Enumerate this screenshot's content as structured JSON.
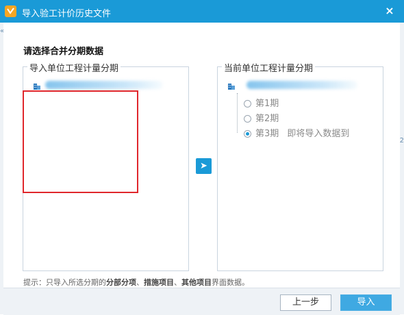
{
  "window": {
    "title": "导入验工计价历史文件",
    "close_glyph": "×"
  },
  "heading": "请选择合并分期数据",
  "left_group": {
    "title": "导入单位工程计量分期"
  },
  "right_group": {
    "title": "当前单位工程计量分期",
    "periods": [
      {
        "label": "第1期",
        "suffix": "",
        "checked": false
      },
      {
        "label": "第2期",
        "suffix": "",
        "checked": false
      },
      {
        "label": "第3期",
        "suffix": "即将导入数据到",
        "checked": true
      }
    ]
  },
  "transfer_button": {
    "icon": "arrow-right-icon",
    "glyph": "➤"
  },
  "hint": {
    "prefix": "提示：只导入所选分期的",
    "bold1": "分部分项",
    "sep1": "、",
    "bold2": "措施项目",
    "sep2": "、",
    "bold3": "其他项目",
    "suffix": "界面数据。"
  },
  "footer": {
    "prev_label": "上一步",
    "import_label": "导入"
  },
  "colors": {
    "titlebar": "#1a9ad7",
    "accent": "#3fa9e2",
    "annotation_red": "#e0262b"
  }
}
